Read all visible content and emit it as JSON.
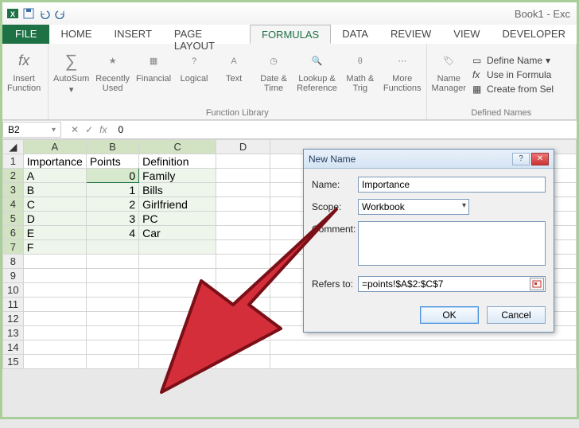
{
  "window": {
    "title": "Book1 - Exc"
  },
  "qat": {
    "save": "Save",
    "undo": "Undo",
    "redo": "Redo"
  },
  "tabs": {
    "file": "FILE",
    "home": "HOME",
    "insert": "INSERT",
    "page_layout": "PAGE LAYOUT",
    "formulas": "FORMULAS",
    "data": "DATA",
    "review": "REVIEW",
    "view": "VIEW",
    "developer": "DEVELOPER"
  },
  "ribbon": {
    "insert_function": "Insert\nFunction",
    "autosum": "AutoSum",
    "recently_used": "Recently\nUsed",
    "financial": "Financial",
    "logical": "Logical",
    "text": "Text",
    "date_time": "Date &\nTime",
    "lookup_ref": "Lookup &\nReference",
    "math_trig": "Math &\nTrig",
    "more_functions": "More\nFunctions",
    "group1_label": "Function Library",
    "name_manager": "Name\nManager",
    "define_name": "Define Name",
    "use_in_formula": "Use in Formula",
    "create_from_sel": "Create from Sel",
    "group2_label": "Defined Names"
  },
  "namebox": {
    "ref": "B2"
  },
  "formula_bar": {
    "value": "0"
  },
  "col_headers": [
    "A",
    "B",
    "C",
    "D"
  ],
  "row_headers": [
    "1",
    "2",
    "3",
    "4",
    "5",
    "6",
    "7",
    "8",
    "9",
    "10",
    "11",
    "12",
    "13",
    "14",
    "15"
  ],
  "cells": {
    "A1": "Importance",
    "B1": "Points",
    "C1": "Definition",
    "A2": "A",
    "B2": "0",
    "C2": "Family",
    "A3": "B",
    "B3": "1",
    "C3": "Bills",
    "A4": "C",
    "B4": "2",
    "C4": "Girlfriend",
    "A5": "D",
    "B5": "3",
    "C5": "PC",
    "A6": "E",
    "B6": "4",
    "C6": "Car",
    "A7": "F"
  },
  "dialog": {
    "title": "New Name",
    "name_label": "Name:",
    "name_value": "Importance",
    "scope_label": "Scope:",
    "scope_value": "Workbook",
    "comment_label": "Comment:",
    "comment_value": "",
    "refers_label": "Refers to:",
    "refers_value": "=points!$A$2:$C$7",
    "ok": "OK",
    "cancel": "Cancel"
  }
}
